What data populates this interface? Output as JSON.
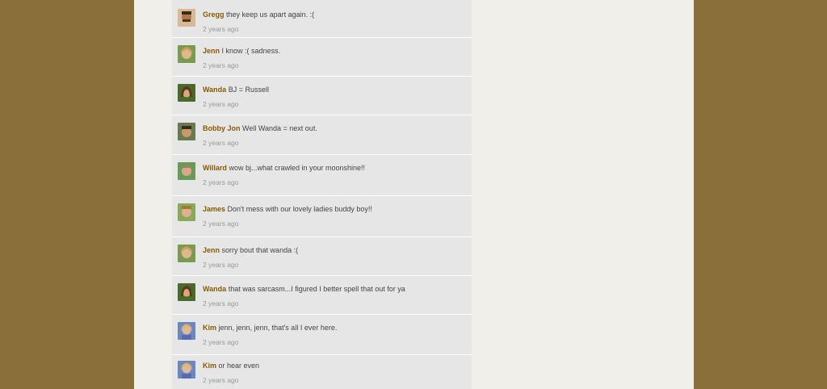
{
  "comments": [
    {
      "user": "Gregg",
      "text": "they keep us apart again.  :(",
      "time": "2 years ago"
    },
    {
      "user": "Jenn",
      "text": "I know :( sadness.",
      "time": "2 years ago"
    },
    {
      "user": "Wanda",
      "text": "BJ = Russell",
      "time": "2 years ago"
    },
    {
      "user": "Bobby Jon",
      "text": "Well Wanda = next out.",
      "time": "2 years ago"
    },
    {
      "user": "Willard",
      "text": "wow bj...what crawled in your moonshine!!",
      "time": "2 years ago"
    },
    {
      "user": "James",
      "text": "Don't mess with our lovely ladies buddy boy!!",
      "time": "2 years ago"
    },
    {
      "user": "Jenn",
      "text": "sorry bout that wanda :(",
      "time": "2 years ago"
    },
    {
      "user": "Wanda",
      "text": "that was sarcasm...I figured I better spell that out for ya",
      "time": "2 years ago"
    },
    {
      "user": "Kim",
      "text": "jenn, jenn, jenn, that's all I ever here.",
      "time": "2 years ago"
    },
    {
      "user": "Kim",
      "text": "or hear even",
      "time": "2 years ago"
    }
  ],
  "colors": {
    "outer_background": "#8a6f3a",
    "page_background": "#f1efea",
    "feed_background": "#e6e6e6",
    "username": "#8a5a00",
    "timestamp": "#999999"
  }
}
